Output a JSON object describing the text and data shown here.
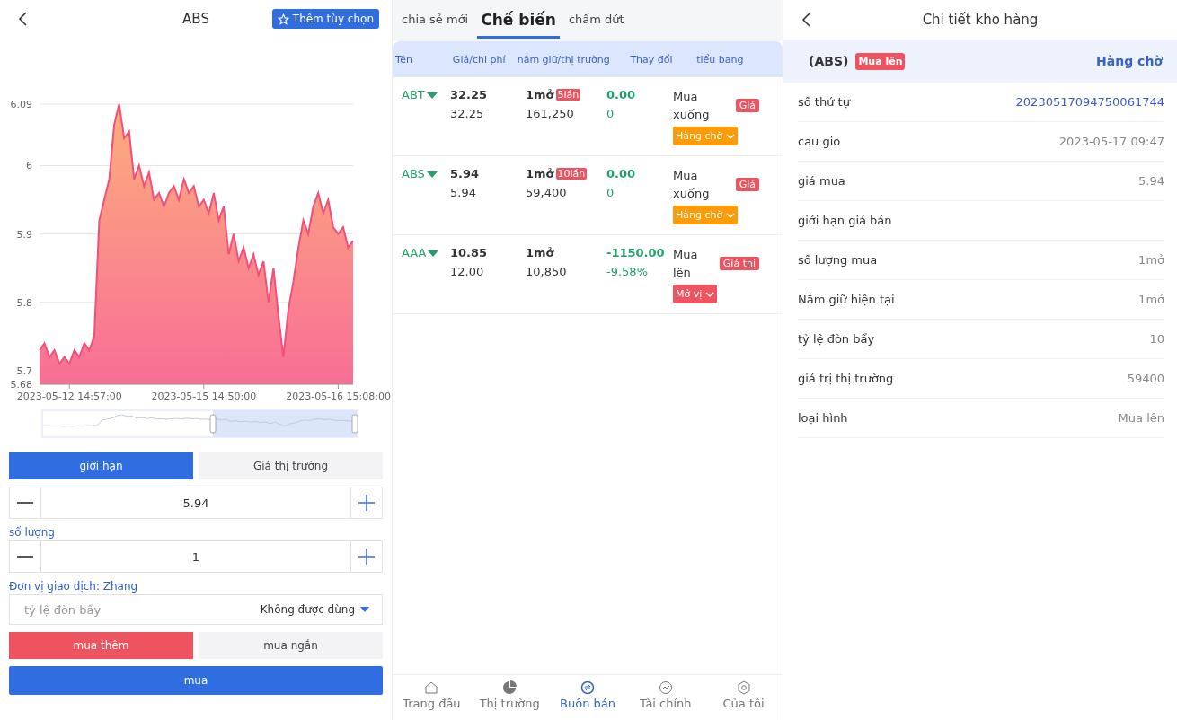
{
  "left": {
    "title": "ABS",
    "favorite_button": "Thêm tùy chọn",
    "chart_data": {
      "type": "area",
      "categories": [
        null,
        null,
        null,
        null,
        null,
        null,
        "2023-05-12 14:57:00",
        null,
        null,
        null,
        null,
        null,
        null,
        null,
        null,
        null,
        null,
        null,
        null,
        null,
        null,
        null,
        null,
        null,
        null,
        null,
        null,
        null,
        null,
        null,
        null,
        null,
        null,
        "2023-05-15 14:50:00",
        null,
        null,
        null,
        null,
        null,
        null,
        null,
        null,
        null,
        null,
        null,
        null,
        null,
        null,
        null,
        null,
        null,
        null,
        null,
        null,
        null,
        null,
        null,
        null,
        null,
        null,
        "2023-05-16 15:08:00",
        null,
        null,
        null
      ],
      "series": [
        {
          "color": "#f0507a",
          "values": [
            5.73,
            5.74,
            5.72,
            5.73,
            5.71,
            5.72,
            5.71,
            5.73,
            5.72,
            5.74,
            5.73,
            5.75,
            5.92,
            5.95,
            5.98,
            6.06,
            6.09,
            6.04,
            6.05,
            5.98,
            6.0,
            5.97,
            5.99,
            5.95,
            5.96,
            5.94,
            5.96,
            5.97,
            5.95,
            5.98,
            5.96,
            5.97,
            5.94,
            5.95,
            5.93,
            5.96,
            5.92,
            5.94,
            5.87,
            5.9,
            5.86,
            5.88,
            5.85,
            5.87,
            5.84,
            5.86,
            5.8,
            5.85,
            5.78,
            5.72,
            5.79,
            5.83,
            5.88,
            5.92,
            5.9,
            5.94,
            5.96,
            5.93,
            5.95,
            5.91,
            5.9,
            5.91,
            5.88,
            5.89
          ]
        }
      ],
      "ylim": [
        5.68,
        6.09
      ],
      "grid": true,
      "yticks": [
        5.68,
        5.7,
        5.8,
        5.9,
        6,
        6.09
      ]
    },
    "order_types": [
      {
        "label": "giới hạn",
        "selected": true
      },
      {
        "label": "Giá thị trường",
        "selected": false
      }
    ],
    "price_value": "5.94",
    "quantity_label": "số lượng",
    "quantity_value": "1",
    "unit_label": "Đơn vị giao dịch: Zhang",
    "leverage": {
      "placeholder": "tỷ lệ đòn bẩy",
      "option": "Không được dùng"
    },
    "directions": [
      {
        "label": "mua thêm",
        "selected": true
      },
      {
        "label": "mua ngắn",
        "selected": false
      }
    ],
    "submit_button": "mua"
  },
  "middle": {
    "tabs": [
      {
        "label": "chia sẻ mới",
        "selected": false
      },
      {
        "label": "Chế biến",
        "selected": true
      },
      {
        "label": "chấm dứt",
        "selected": false
      }
    ],
    "columns": [
      "Tên",
      "Giá/chi phí",
      "nắm giữ/thị trường",
      "Thay đổi",
      "tiểu bang"
    ],
    "rows": [
      {
        "name": "ABT",
        "price": "32.25",
        "cost": "32.25",
        "hold": "1mở",
        "times": "5lần",
        "market": "161,250",
        "change": "0.00",
        "change_pct": "0",
        "state": "Mua xuống",
        "tag": "Giá",
        "action": {
          "label": "Hàng chờ",
          "color": "#fe9b06"
        }
      },
      {
        "name": "ABS",
        "price": "5.94",
        "cost": "5.94",
        "hold": "1mở",
        "times": "10lần",
        "market": "59,400",
        "change": "0.00",
        "change_pct": "0",
        "state": "Mua xuống",
        "tag": "Giá",
        "action": {
          "label": "Hàng chờ",
          "color": "#fe9b06"
        }
      },
      {
        "name": "AAA",
        "price": "10.85",
        "cost": "12.00",
        "hold": "1mở",
        "market": "10,850",
        "change": "-1150.00",
        "change_pct": "-9.58%",
        "state": "Mua lên",
        "tag": "Giá thị",
        "action": {
          "label": "Mở vị",
          "color": "#ee5460"
        }
      }
    ],
    "nav": [
      {
        "label": "Trang đầu",
        "kind": "home",
        "selected": false
      },
      {
        "label": "Thị trường",
        "kind": "pie",
        "selected": false
      },
      {
        "label": "Buôn bán",
        "kind": "trade",
        "selected": true
      },
      {
        "label": "Tài chính",
        "kind": "finance",
        "selected": false
      },
      {
        "label": "Của tôi",
        "kind": "me",
        "selected": false
      }
    ]
  },
  "right": {
    "title": "Chi tiết kho hàng",
    "symbol": "(ABS)",
    "badge": "Mua lên",
    "status": "Hàng chờ",
    "rows": [
      {
        "label": "số thứ tự",
        "value": "20230517094750061744",
        "kind": "link"
      },
      {
        "label": "cau gio",
        "value": "2023-05-17 09:47",
        "kind": "text"
      },
      {
        "label": "giá mua",
        "value": "5.94",
        "kind": "text"
      },
      {
        "label": "giới hạn giá bán",
        "kind": "text"
      },
      {
        "label": "số lượng mua",
        "value": "1mở",
        "kind": "text"
      },
      {
        "label": "Nắm giữ hiện tại",
        "value": "1mở",
        "kind": "text"
      },
      {
        "label": "tỷ lệ đòn bẩy",
        "value": "10",
        "kind": "text"
      },
      {
        "label": "giá trị thị trường",
        "value": "59400",
        "kind": "text"
      },
      {
        "label": "loại hình",
        "value": "Mua lên",
        "kind": "text"
      }
    ]
  }
}
